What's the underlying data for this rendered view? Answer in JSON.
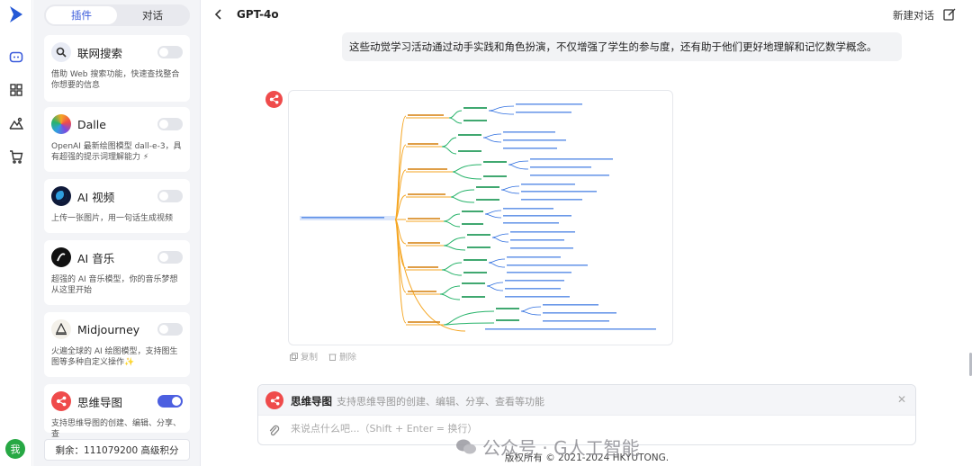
{
  "sidebar": {
    "tabs": [
      {
        "label": "插件",
        "active": true
      },
      {
        "label": "对话",
        "active": false
      }
    ],
    "plugins": [
      {
        "name": "联网搜索",
        "desc": "借助 Web 搜索功能，快速查找整合你想要的信息",
        "icon": "search-icon",
        "enabled": false
      },
      {
        "name": "Dalle",
        "desc": "OpenAI 最新绘图模型 dall-e-3，具有超强的提示词理解能力 ⚡",
        "icon": "dalle-icon",
        "enabled": false
      },
      {
        "name": "AI 视频",
        "desc": "上传一张图片，用一句话生成视频",
        "icon": "video-icon",
        "enabled": false
      },
      {
        "name": "AI 音乐",
        "desc": "超强的 AI 音乐模型，你的音乐梦想从这里开始",
        "icon": "music-icon",
        "enabled": false
      },
      {
        "name": "Midjourney",
        "desc": "火遍全球的 AI 绘图模型，支持图生图等多种自定义操作✨",
        "icon": "midjourney-icon",
        "enabled": false
      },
      {
        "name": "思维导图",
        "desc": "支持思维导图的创建、编辑、分享、查",
        "icon": "mindmap-icon",
        "enabled": true
      }
    ],
    "credit": "剩余：111079200 高级积分",
    "user_initial": "我"
  },
  "header": {
    "model": "GPT-4o",
    "new_chat": "新建对话"
  },
  "chat": {
    "user_message": "这些动觉学习活动通过动手实践和角色扮演，不仅增强了学生的参与度，还有助于他们更好地理解和记忆数学概念。",
    "actions": {
      "copy": "复制",
      "delete": "删除"
    }
  },
  "composer": {
    "plugin_name": "思维导图",
    "plugin_desc": "支持思维导图的创建、编辑、分享、查看等功能",
    "placeholder": "来说点什么吧...（Shift + Enter = 换行）"
  },
  "footer": "版权所有 © 2021-2024 HKYUTONG.",
  "watermark": "公众号 · G人工智能",
  "colors": {
    "accent": "#4c5fe0",
    "mindmap_red": "#ef4b4b",
    "branch_orange": "#f5a623",
    "branch_green": "#27b36a",
    "branch_blue": "#2f6fe0"
  }
}
